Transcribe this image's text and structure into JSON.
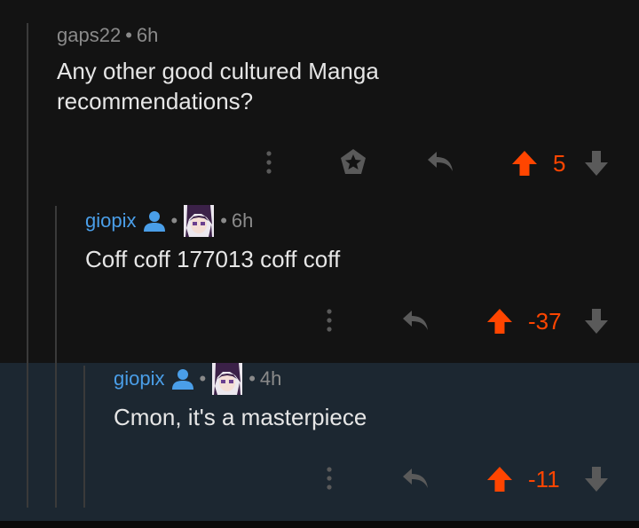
{
  "comments": [
    {
      "username": "gaps22",
      "separator": "•",
      "age": "6h",
      "body_line1": "Any other good cultured Manga",
      "body_line2": "recommendations?",
      "score": "5"
    },
    {
      "username": "giopix",
      "separator": "•",
      "age": "6h",
      "body_line1": "Coff coff 177013 coff coff",
      "score": "-37"
    },
    {
      "username": "giopix",
      "separator": "•",
      "age": "4h",
      "body_line1": "Cmon, it's a masterpiece",
      "score": "-11"
    }
  ],
  "colors": {
    "background": "#131313",
    "highlight": "#1c2731",
    "upvote": "#ff4500",
    "username_blue": "#4a9ee8",
    "text": "#e6e6e6",
    "meta": "#8a8a8a",
    "icon": "#5a5a5a"
  },
  "icons": {
    "more": "more-vertical-icon",
    "award": "award-icon",
    "reply": "reply-icon",
    "upvote": "upvote-arrow-icon",
    "downvote": "downvote-arrow-icon",
    "user": "user-icon",
    "flair": "flair-avatar-icon"
  }
}
